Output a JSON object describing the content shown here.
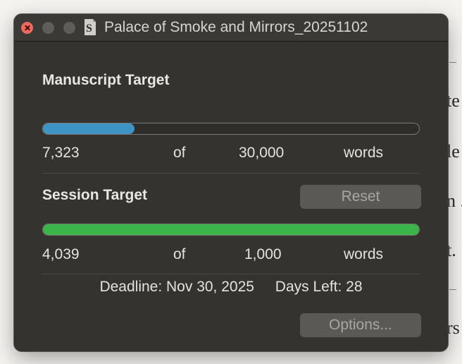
{
  "background_document": {
    "lines": [
      "te",
      "le",
      "n .",
      "t.",
      "rs"
    ]
  },
  "window": {
    "title": "Palace of Smoke and Mirrors_20251102",
    "icon": "scrivener-document-icon"
  },
  "manuscript": {
    "title": "Manuscript Target",
    "progress_fraction": 0.2441,
    "current": "7,323",
    "of": "of",
    "target": "30,000",
    "unit": "words",
    "bar_color": "#3f94c6"
  },
  "session": {
    "title": "Session Target",
    "reset_label": "Reset",
    "progress_fraction": 1.0,
    "current": "4,039",
    "of": "of",
    "target": "1,000",
    "unit": "words",
    "bar_color": "#3bb44a"
  },
  "deadline": {
    "deadline_text": "Deadline: Nov 30, 2025",
    "days_left_text": "Days Left: 28"
  },
  "options_label": "Options..."
}
